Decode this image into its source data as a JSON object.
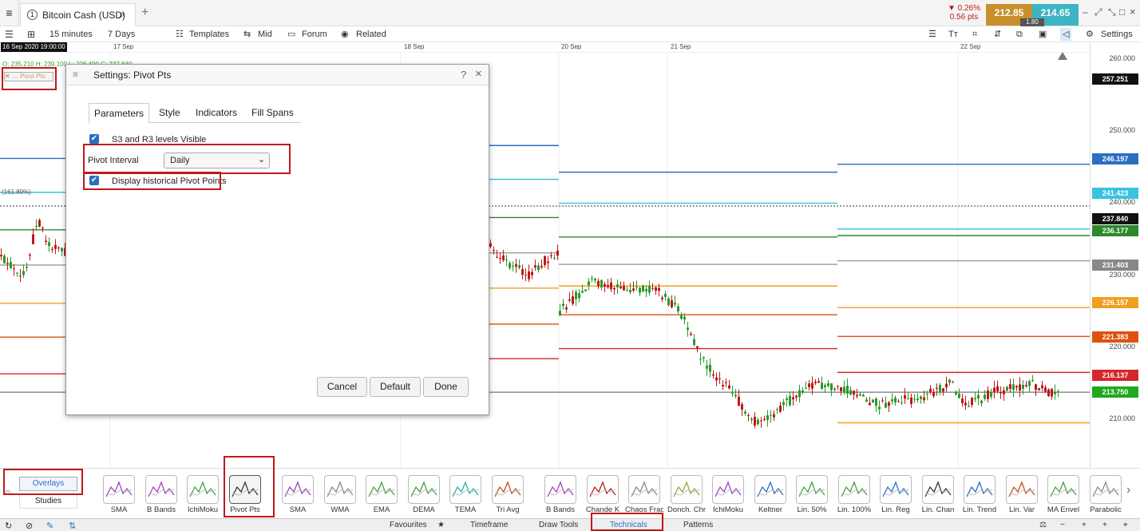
{
  "tabbar": {
    "menu_icon": "hamburger-icon",
    "instrument": "Bitcoin Cash (USD)",
    "instrument_index": "1",
    "change_pct": "▼ 0.26%",
    "change_pts": "0.56 pts",
    "bid": "212.85",
    "ask": "214.65",
    "spread": "1.80"
  },
  "toolbar": {
    "timeframe": "15 minutes",
    "range": "7 Days",
    "templates": "Templates",
    "price_type": "Mid",
    "forum": "Forum",
    "related": "Related",
    "settings": "Settings"
  },
  "datebar": {
    "current": "16 Sep 2020 19:00:00",
    "labels": [
      "17 Sep",
      "18 Sep",
      "20 Sep",
      "21 Sep",
      "22 Sep"
    ]
  },
  "ohlc": "O: 235.210  H: 239.100  L: 226.490  C: 237.840",
  "legend_tag": "Pivot Pts",
  "fib_label": "(161.80%)",
  "yaxis": {
    "ticks": [
      "260.000",
      "250.000",
      "240.000",
      "230.000",
      "220.000",
      "210.000"
    ],
    "badges": [
      {
        "v": "257.251",
        "c": "#111111"
      },
      {
        "v": "246.197",
        "c": "#2a6fc0"
      },
      {
        "v": "241.423",
        "c": "#39c3e0"
      },
      {
        "v": "237.840",
        "c": "#111111"
      },
      {
        "v": "236.177",
        "c": "#2b8a2b"
      },
      {
        "v": "231.403",
        "c": "#888888"
      },
      {
        "v": "226.157",
        "c": "#f0a020"
      },
      {
        "v": "221.383",
        "c": "#e05010"
      },
      {
        "v": "216.137",
        "c": "#d4272b"
      },
      {
        "v": "213.750",
        "c": "#20a820"
      }
    ]
  },
  "dialog": {
    "title": "Settings: Pivot Pts",
    "help": "?",
    "close": "×",
    "tabs": [
      "Parameters",
      "Style",
      "Indicators",
      "Fill Spans"
    ],
    "s3r3_label": "S3 and R3 levels Visible",
    "interval_label": "Pivot Interval",
    "interval_value": "Daily",
    "historical_label": "Display historical Pivot Points",
    "cancel": "Cancel",
    "default": "Default",
    "done": "Done"
  },
  "studies_side": {
    "overlays": "Overlays",
    "studies": "Studies"
  },
  "studies": [
    "SMA",
    "B Bands",
    "IchiMoku",
    "Pivot Pts",
    "SMA",
    "WMA",
    "EMA",
    "DEMA",
    "TEMA",
    "Tri Avg",
    "B Bands",
    "Chande K",
    "Chaos Frac",
    "Donch. Chnl",
    "IchiMoku",
    "Keltner",
    "Lin. 50%",
    "Lin. 100%",
    "Lin. Reg",
    "Lin. Chan",
    "Lin. Trend",
    "Lin. Var",
    "MA Envel",
    "Parabolic"
  ],
  "bottom": {
    "favourites": "Favourites",
    "timeframe": "Timeframe",
    "draw_tools": "Draw Tools",
    "technicals": "Technicals",
    "patterns": "Patterns"
  },
  "chart_data": {
    "type": "candlestick",
    "ylim": [
      206,
      262
    ],
    "pivot_levels": {
      "day1": {
        "x": [
          0,
          83
        ],
        "R3": 246.2,
        "R2": 241.5,
        "R1": 236.3,
        "P": 231.4,
        "S1": 226.1,
        "S2": 221.4,
        "S3": 216.3
      },
      "day2": {
        "x": [
          613,
          700
        ],
        "R3": 248.0,
        "R2": 243.3,
        "R1": 238.0,
        "P": 233.1,
        "S1": 228.2,
        "S2": 223.2,
        "S3": 218.4
      },
      "day3": {
        "x": [
          700,
          1049
        ],
        "R3": 244.3,
        "R2": 240.0,
        "R1": 235.3,
        "P": 231.5,
        "S1": 228.5,
        "S2": 224.5,
        "S3": 219.8
      },
      "day4": {
        "x": [
          1049,
          1368
        ],
        "R3": 245.4,
        "R2": 236.4,
        "P": 232.0,
        "R1": 235.5,
        "S1": 225.5,
        "S2": 221.5,
        "S3": 216.5,
        "low": 209.5
      }
    },
    "price_line": 213.75,
    "dotted_line": 239.6
  }
}
